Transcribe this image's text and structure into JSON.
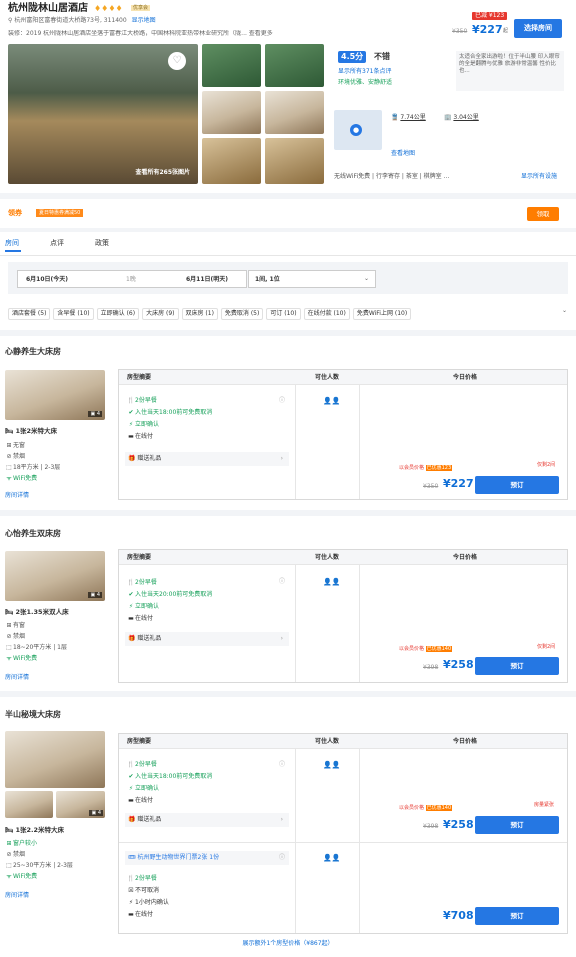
{
  "hotel": {
    "name": "杭州陇林山居酒店",
    "stars": "♦♦♦♦",
    "badge": "优享会",
    "address": "杭州富阳区富春街道大桥路73号, 311400",
    "map_link": "显示地图",
    "intro": "装修：2019  杭州陇林山居酒店坐落于富春江大桥路，中国林科院亚热带林业研究所（陇... 查看更多",
    "view_all_photos": "查看所有265张图片"
  },
  "price_box": {
    "discount": "已减 ¥123",
    "old_price": "¥350",
    "price": "¥227",
    "unit": "起",
    "choose_btn": "选择房间"
  },
  "rating": {
    "score": "4.5分",
    "label": "不错",
    "reviews": "显示所有371条点评",
    "tags": "环境优雅、安静舒适",
    "quote": "太适合全家出游啦！位于半山腰 印入眼帘的全是翻腾与优雅 旅游非常温馨 性价比也..."
  },
  "location": {
    "dist1": "7.74公里",
    "dist2": "3.04公里",
    "map_link": "查看地图"
  },
  "facilities": {
    "list": "无线WiFi免费 | 行李寄存 | 茶室 | 棋牌室 ...",
    "all": "显示所有设施"
  },
  "coupon": {
    "label": "领券",
    "tag": "夏日特惠券满减50",
    "claim": "领取"
  },
  "tabs": [
    "房间",
    "点评",
    "政策"
  ],
  "search": {
    "checkin": "6月10日(今天)",
    "nights": "1晚",
    "checkout": "6月11日(明天)",
    "guests": "1间, 1位"
  },
  "filters": [
    "酒店套餐 (5)",
    "含早餐 (10)",
    "立即确认 (6)",
    "大床房 (9)",
    "双床房 (1)",
    "免费取消 (5)",
    "可订 (10)",
    "在线付款 (10)",
    "免费WiFi上网 (10)"
  ],
  "table": {
    "col1": "房型摘要",
    "col2": "可住人数",
    "col3": "今日价格"
  },
  "rooms": [
    {
      "title": "心静养生大床房",
      "img_count": "4",
      "bed": "1张2米特大床",
      "window": "无窗",
      "smoke": "禁烟",
      "size": "18平方米 | 2-3层",
      "wifi": "WiFi免费",
      "details": "房间详情",
      "plans": [
        {
          "meal": "2份早餐",
          "cancel": "入住当天18:00前可免费取消",
          "confirm": "立即确认",
          "pay": "在线付",
          "gift": "赠送礼品",
          "tag1": "以会员价格",
          "tag2": "已优惠123",
          "promo": "仅剩2间",
          "old": "¥350",
          "price": "¥227",
          "book": "预订"
        }
      ]
    },
    {
      "title": "心怡养生双床房",
      "img_count": "4",
      "bed": "2张1.35米双人床",
      "window": "有窗",
      "smoke": "禁烟",
      "size": "18~20平方米 | 1层",
      "wifi": "WiFi免费",
      "details": "房间详情",
      "plans": [
        {
          "meal": "2份早餐",
          "cancel": "入住当天20:00前可免费取消",
          "confirm": "立即确认",
          "pay": "在线付",
          "gift": "赠送礼品",
          "tag1": "以会员价格",
          "tag2": "已优惠140",
          "promo": "仅剩2间",
          "old": "¥398",
          "price": "¥258",
          "book": "预订"
        }
      ]
    },
    {
      "title": "半山秘境大床房",
      "img_count": "4",
      "bed": "1张2.2米特大床",
      "window": "窗户较小",
      "smoke": "禁烟",
      "size": "25~30平方米 | 2-3层",
      "wifi": "WiFi免费",
      "details": "房间详情",
      "plans": [
        {
          "meal": "2份早餐",
          "cancel": "入住当天18:00前可免费取消",
          "confirm": "立即确认",
          "pay": "在线付",
          "gift": "赠送礼品",
          "tag1": "以会员价格",
          "tag2": "已优惠140",
          "promo": "房量紧张",
          "old": "¥398",
          "price": "¥258",
          "book": "预订"
        },
        {
          "package": "杭州野生动物世界门票2张 1份",
          "meal": "2份早餐",
          "cancel": "不可取消",
          "confirm": "1小时内确认",
          "pay": "在线付",
          "price": "¥708",
          "book": "预订"
        }
      ]
    }
  ],
  "more_rooms": "展示额外1个房型价格（¥867起）"
}
